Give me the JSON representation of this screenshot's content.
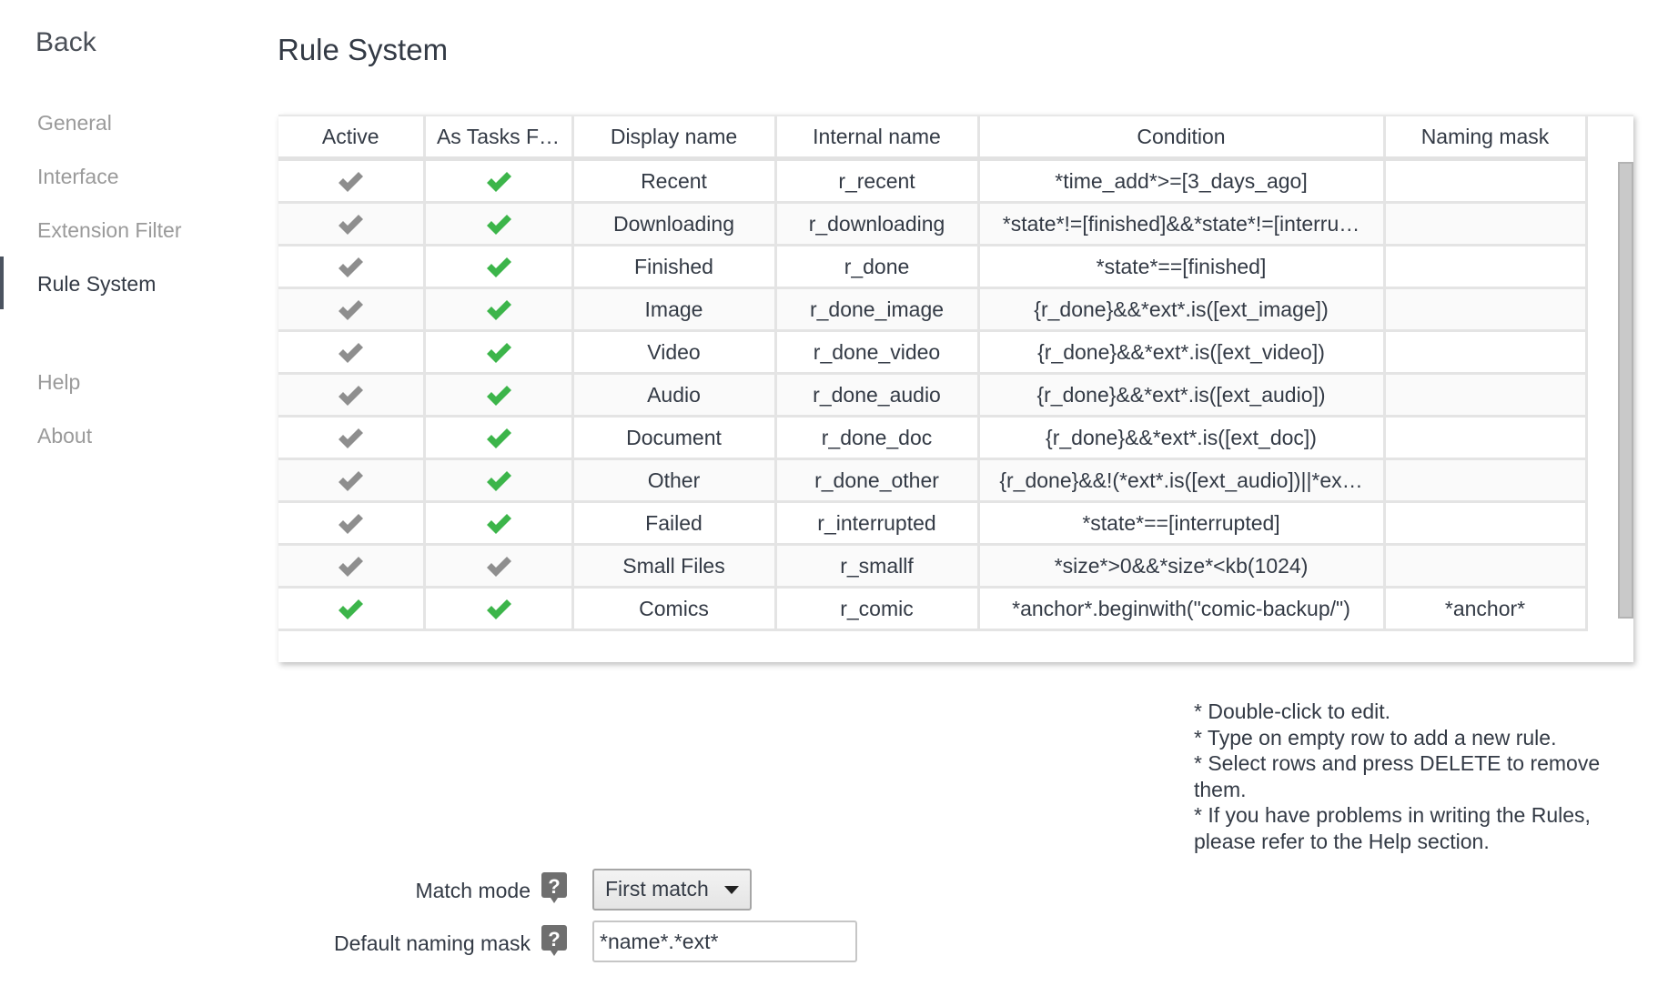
{
  "sidebar": {
    "back_label": "Back",
    "items": [
      {
        "label": "General",
        "active": false
      },
      {
        "label": "Interface",
        "active": false
      },
      {
        "label": "Extension Filter",
        "active": false
      },
      {
        "label": "Rule System",
        "active": true
      },
      {
        "label": "Help",
        "active": false
      },
      {
        "label": "About",
        "active": false
      }
    ]
  },
  "page": {
    "title": "Rule System"
  },
  "colors": {
    "check_on": "#3cb54a",
    "check_off": "#8e8e8e",
    "active_indicator": "#4b5360"
  },
  "table": {
    "columns": [
      "Active",
      "As Tasks F…",
      "Display name",
      "Internal name",
      "Condition",
      "Naming mask"
    ],
    "rows": [
      {
        "active": false,
        "as_tasks_filter": true,
        "display_name": "Recent",
        "internal_name": "r_recent",
        "condition": "*time_add*>=[3_days_ago]",
        "naming_mask": ""
      },
      {
        "active": false,
        "as_tasks_filter": true,
        "display_name": "Downloading",
        "internal_name": "r_downloading",
        "condition": "*state*!=[finished]&&*state*!=[interru…",
        "naming_mask": ""
      },
      {
        "active": false,
        "as_tasks_filter": true,
        "display_name": "Finished",
        "internal_name": "r_done",
        "condition": "*state*==[finished]",
        "naming_mask": ""
      },
      {
        "active": false,
        "as_tasks_filter": true,
        "display_name": "Image",
        "internal_name": "r_done_image",
        "condition": "{r_done}&&*ext*.is([ext_image])",
        "naming_mask": ""
      },
      {
        "active": false,
        "as_tasks_filter": true,
        "display_name": "Video",
        "internal_name": "r_done_video",
        "condition": "{r_done}&&*ext*.is([ext_video])",
        "naming_mask": ""
      },
      {
        "active": false,
        "as_tasks_filter": true,
        "display_name": "Audio",
        "internal_name": "r_done_audio",
        "condition": "{r_done}&&*ext*.is([ext_audio])",
        "naming_mask": ""
      },
      {
        "active": false,
        "as_tasks_filter": true,
        "display_name": "Document",
        "internal_name": "r_done_doc",
        "condition": "{r_done}&&*ext*.is([ext_doc])",
        "naming_mask": ""
      },
      {
        "active": false,
        "as_tasks_filter": true,
        "display_name": "Other",
        "internal_name": "r_done_other",
        "condition": "{r_done}&&!(*ext*.is([ext_audio])||*ex…",
        "naming_mask": ""
      },
      {
        "active": false,
        "as_tasks_filter": true,
        "display_name": "Failed",
        "internal_name": "r_interrupted",
        "condition": "*state*==[interrupted]",
        "naming_mask": ""
      },
      {
        "active": false,
        "as_tasks_filter": false,
        "display_name": "Small Files",
        "internal_name": "r_smallf",
        "condition": "*size*>0&&*size*<kb(1024)",
        "naming_mask": ""
      },
      {
        "active": true,
        "as_tasks_filter": true,
        "display_name": "Comics",
        "internal_name": "r_comic",
        "condition": "*anchor*.beginwith(\"comic-backup/\")",
        "naming_mask": "*anchor*"
      }
    ]
  },
  "hints": [
    "* Double-click to edit.",
    "* Type on empty row to add a new rule.",
    "* Select rows and press DELETE to remove them.",
    "* If you have problems in writing the Rules, please refer to the Help section."
  ],
  "settings": {
    "match_mode": {
      "label": "Match mode",
      "value": "First match",
      "help_icon": "help-question-icon"
    },
    "default_naming_mask": {
      "label": "Default naming mask",
      "value": "*name*.*ext*",
      "help_icon": "help-question-icon"
    }
  }
}
